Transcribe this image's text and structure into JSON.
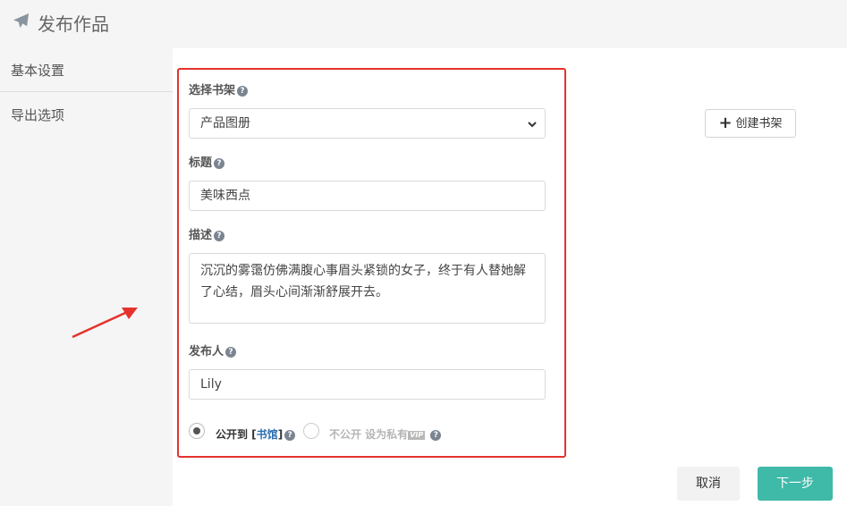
{
  "header": {
    "title": "发布作品",
    "icon": "paper-plane-icon"
  },
  "sidebar": {
    "items": [
      {
        "label": "基本设置"
      },
      {
        "label": "导出选项"
      }
    ]
  },
  "form": {
    "shelf": {
      "label": "选择书架",
      "value": "产品图册"
    },
    "title": {
      "label": "标题",
      "value": "美味西点"
    },
    "description": {
      "label": "描述",
      "value": "沉沉的雾霭仿佛满腹心事眉头紧锁的女子，终于有人替她解了心结，眉头心间渐渐舒展开去。"
    },
    "publisher": {
      "label": "发布人",
      "value": "Lily"
    },
    "visibility": {
      "public_prefix": "公开到 [",
      "public_link": "书馆",
      "public_suffix": "]",
      "private_label": "不公开 设为私有",
      "vip_badge": "VIP",
      "selected": "public"
    }
  },
  "buttons": {
    "create_shelf": "创建书架",
    "cancel": "取消",
    "next": "下一步"
  },
  "colors": {
    "accent": "#3fb9a8",
    "highlight_border": "#e5322d",
    "link": "#2a6db0"
  }
}
